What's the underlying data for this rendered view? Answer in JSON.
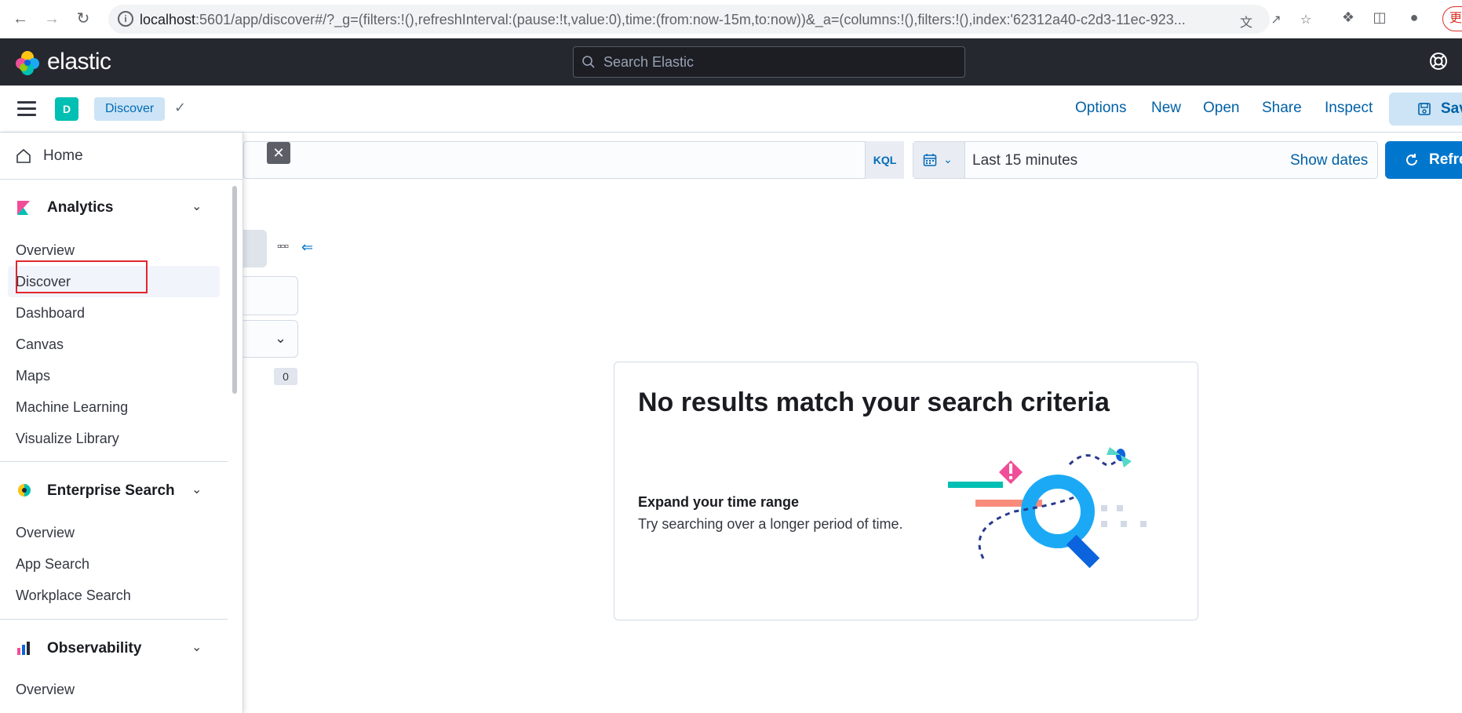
{
  "browser": {
    "url_host": "localhost",
    "url_rest": ":5601/app/discover#/?_g=(filters:!(),refreshInterval:(pause:!t,value:0),time:(from:now-15m,to:now))&_a=(columns:!(),filters:!(),index:'62312a40-c2d3-11ec-923...",
    "update_label": "更新"
  },
  "header": {
    "brand": "elastic",
    "search_placeholder": "Search Elastic"
  },
  "subheader": {
    "space_initial": "D",
    "breadcrumb": "Discover",
    "links": [
      "Options",
      "New",
      "Open",
      "Share",
      "Inspect"
    ],
    "save_label": "Save"
  },
  "querybar": {
    "language": "KQL",
    "time_range": "Last 15 minutes",
    "show_dates": "Show dates",
    "refresh_label": "Refresh"
  },
  "sidebar_panel": {
    "field_count": "0"
  },
  "empty_state": {
    "title": "No results match your search criteria",
    "subtitle": "Expand your time range",
    "body": "Try searching over a longer period of time."
  },
  "sidenav": {
    "home": "Home",
    "groups": [
      {
        "title": "Analytics",
        "items": [
          "Overview",
          "Discover",
          "Dashboard",
          "Canvas",
          "Maps",
          "Machine Learning",
          "Visualize Library"
        ]
      },
      {
        "title": "Enterprise Search",
        "items": [
          "Overview",
          "App Search",
          "Workplace Search"
        ]
      },
      {
        "title": "Observability",
        "items": [
          "Overview"
        ]
      }
    ]
  },
  "colors": {
    "header_bg": "#25282f",
    "accent": "#0077cc",
    "breadcrumb_bg": "#cce4f5",
    "highlight": "#e0262e"
  }
}
